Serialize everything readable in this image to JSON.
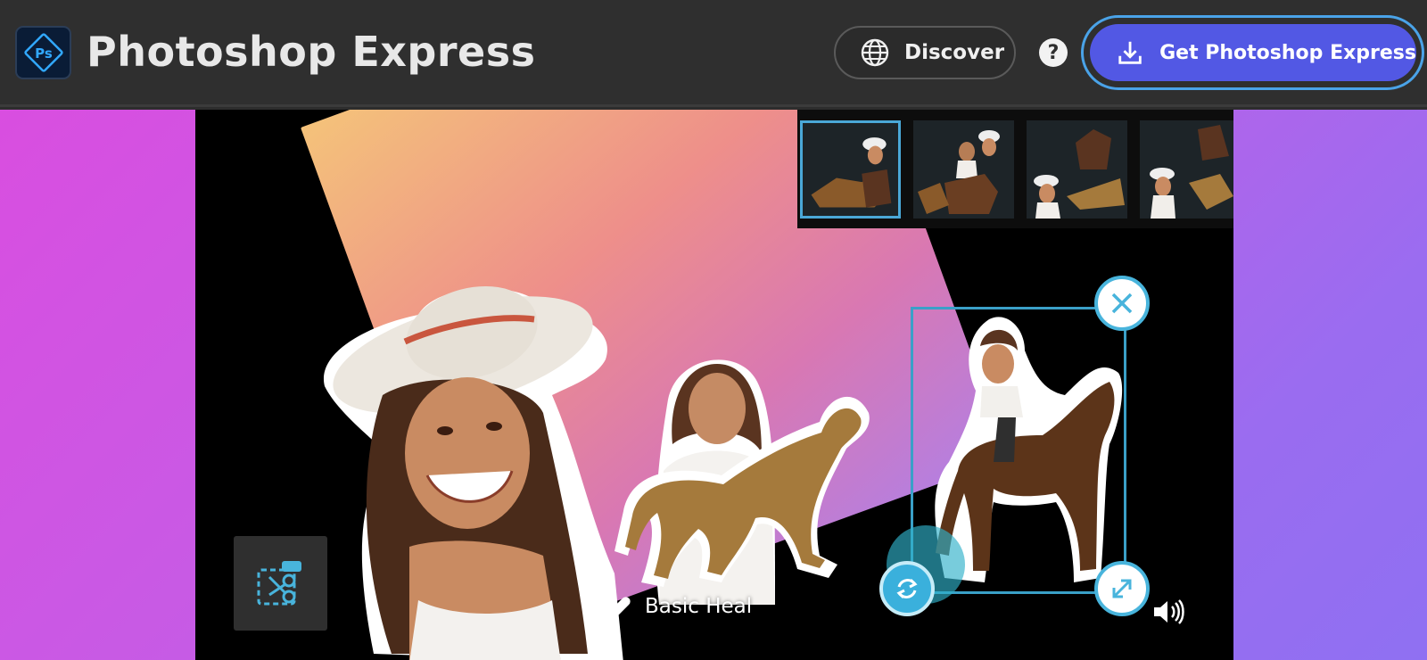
{
  "header": {
    "logo_text": "Ps",
    "title": "Photoshop Express",
    "discover_label": "Discover",
    "help_label": "?",
    "get_app_label": "Get Photoshop Express"
  },
  "video": {
    "caption": "Basic Heal",
    "thumbnails": [
      "thumbnail-1",
      "thumbnail-2",
      "thumbnail-3",
      "thumbnail-4"
    ],
    "selected_thumbnail": 1
  },
  "icons": {
    "discover": "globe-icon",
    "help": "question-icon",
    "download": "download-icon",
    "close": "close-icon",
    "resize": "resize-icon",
    "rotate": "rotate-icon",
    "cutout": "cutout-scissors-icon",
    "heal": "bandage-icon",
    "volume": "volume-icon"
  },
  "colors": {
    "accent": "#5258e4",
    "handle_accent": "#48b4dc",
    "header_bg": "#2f2f2f"
  }
}
